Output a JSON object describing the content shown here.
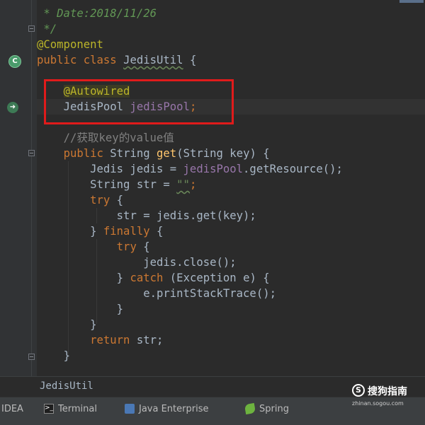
{
  "app": {
    "name": "IntelliJ IDEA"
  },
  "editor": {
    "lines": {
      "date_prefix": " * ",
      "date_text": "Date:2018/11/26",
      "end_comment": " */",
      "component": "@Component",
      "class_public": "public",
      "class_class": "class",
      "class_name": "JedisUtil",
      "class_brace": "{",
      "autowired": "@Autowired",
      "pool_type": "JedisPool",
      "pool_field": "jedisPool",
      "semicolon": ";",
      "comment_get": "//获取key的value值",
      "m_public": "public",
      "m_sig_a": "String",
      "m_name": "get",
      "m_sig_b": "(String key) {",
      "jedis_decl": "Jedis jedis = ",
      "jedis_field": "jedisPool",
      "jedis_call": ".getResource();",
      "str_decl": "String str = ",
      "str_val": "\"\"",
      "try_kw": "try",
      "brace_open": " {",
      "str_assign": "str = jedis.get(key);",
      "close_brace_pre": "} ",
      "finally_kw": "finally",
      "close_call": "jedis.close();",
      "catch_kw": "catch",
      "catch_args": " (Exception e) {",
      "print_trace": "e.printStackTrace();",
      "brace_close": "}",
      "return_kw": "return",
      "return_val": " str;"
    }
  },
  "breadcrumb": {
    "label": "JedisUtil"
  },
  "toolbar": {
    "items": [
      {
        "label": "IDEA",
        "icon": "none"
      },
      {
        "label": "Terminal",
        "icon": "terminal-icon"
      },
      {
        "label": "Java Enterprise",
        "icon": "java-enterprise-icon"
      },
      {
        "label": "Spring",
        "icon": "spring-icon"
      }
    ]
  },
  "watermark": {
    "name": "搜狗指南",
    "url": "zhinan.sogou.com",
    "logo": "S"
  },
  "colors": {
    "background": "#2b2b2b",
    "gutter": "#313335",
    "keyword": "#cc7832",
    "annotation": "#bbb529",
    "field": "#9876aa",
    "doc_comment": "#629755",
    "line_comment": "#808080",
    "string": "#6a8759",
    "method": "#ffc66d",
    "highlight_box": "#e01b1b"
  }
}
